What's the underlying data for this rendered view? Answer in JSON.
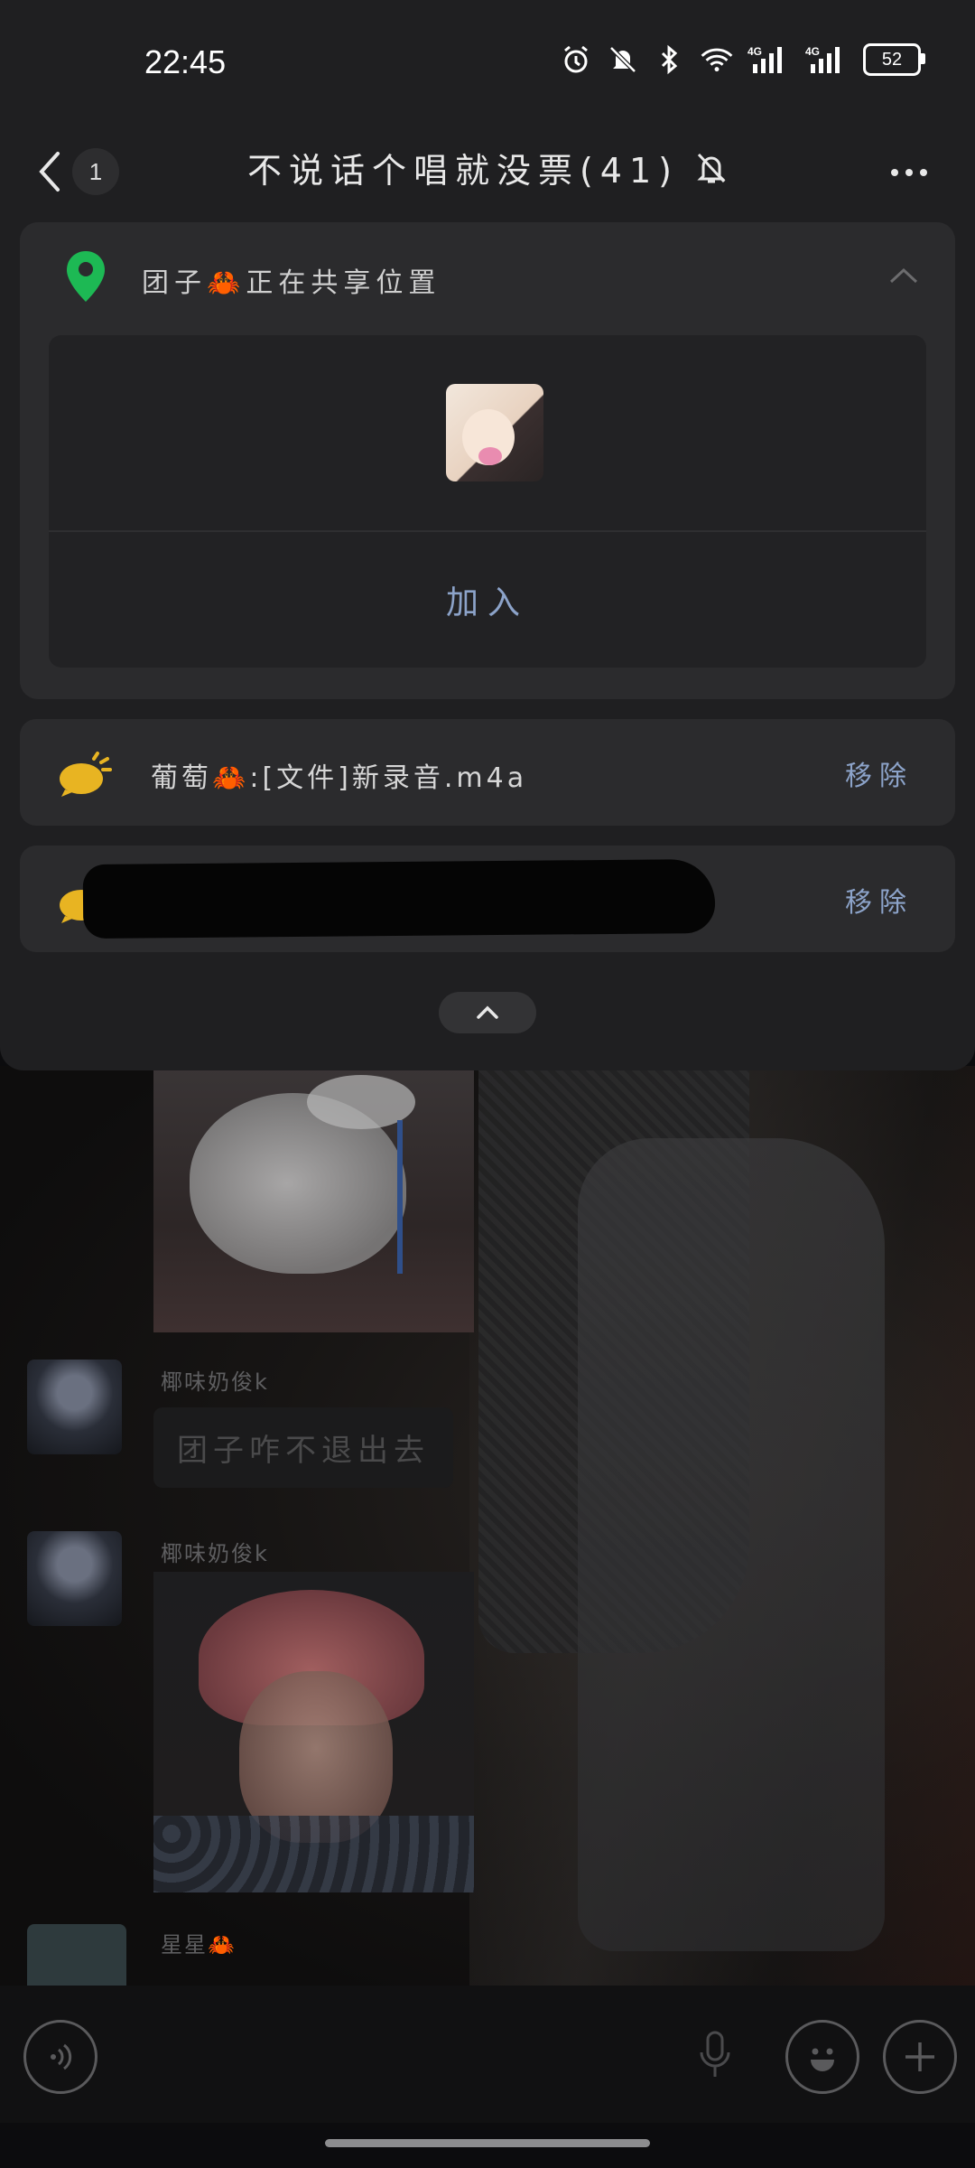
{
  "status_bar": {
    "time": "22:45",
    "battery": "52",
    "icons": [
      "alarm-icon",
      "mute-icon",
      "bluetooth-icon",
      "wifi-icon",
      "signal-4g-icon",
      "signal-4g-icon"
    ],
    "network_labels": [
      "4G",
      "4G"
    ]
  },
  "title_bar": {
    "unread_count": "1",
    "group_title": "不说话个唱就没票(41)",
    "muted_icon": "bell-off-icon"
  },
  "location_share": {
    "text": "团子🦀正在共享位置",
    "join_label": "加入"
  },
  "notices": [
    {
      "text": "葡萄🦀:[文件]新录音.m4a",
      "remove_label": "移除"
    },
    {
      "remove_label": "移除"
    }
  ],
  "chat": {
    "messages": [
      {
        "sender": "椰味奶俊k",
        "text": "团子咋不退出去"
      },
      {
        "sender": "椰味奶俊k"
      },
      {
        "sender": "星星🦀"
      }
    ]
  },
  "colors": {
    "accent": "#8ca3c9",
    "panel": "#1f1f21",
    "card": "#2b2b2d",
    "pin_green": "#1db954",
    "notice_yellow": "#e8b422"
  }
}
